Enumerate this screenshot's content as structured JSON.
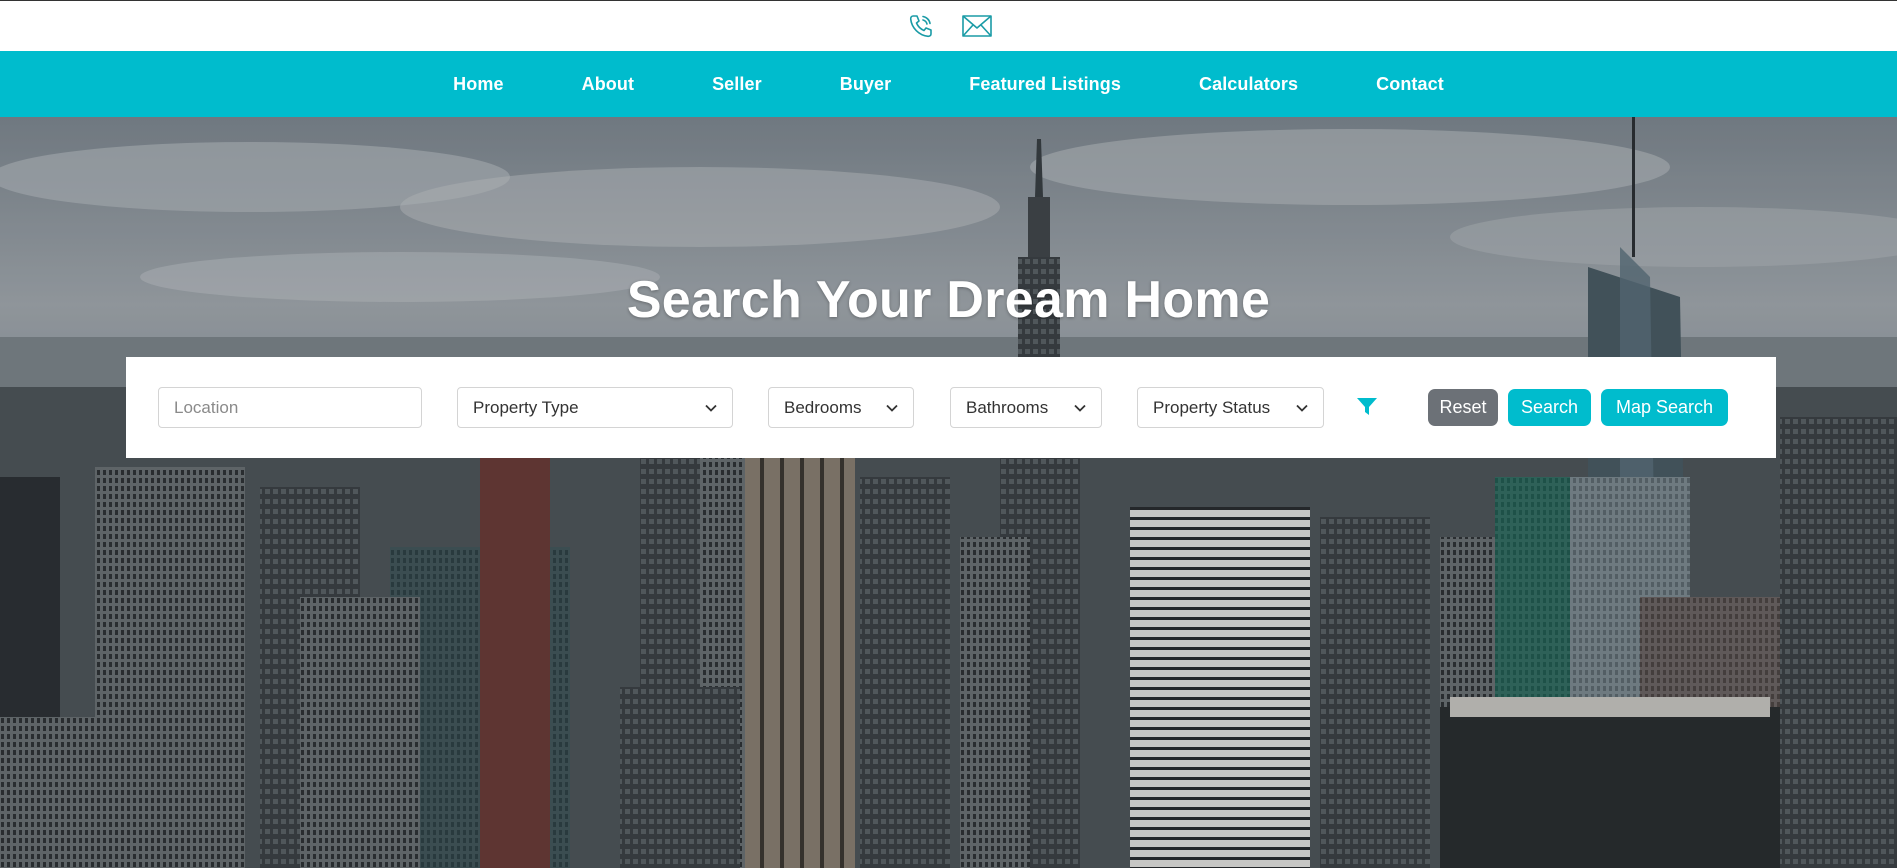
{
  "topbar": {
    "icons": [
      "phone-icon",
      "mail-icon"
    ],
    "icon_color": "#1a9ba6"
  },
  "nav": {
    "items": [
      {
        "label": "Home"
      },
      {
        "label": "About"
      },
      {
        "label": "Seller"
      },
      {
        "label": "Buyer"
      },
      {
        "label": "Featured Listings"
      },
      {
        "label": "Calculators"
      },
      {
        "label": "Contact"
      }
    ],
    "bg_color": "#00bccd"
  },
  "hero": {
    "title": "Search Your Dream Home"
  },
  "search": {
    "location_placeholder": "Location",
    "property_type": "Property Type",
    "bedrooms": "Bedrooms",
    "bathrooms": "Bathrooms",
    "property_status": "Property Status",
    "filter_icon": "filter-icon",
    "reset_label": "Reset",
    "search_label": "Search",
    "map_search_label": "Map Search",
    "accent_color": "#00bccd",
    "reset_color": "#6c7177"
  }
}
